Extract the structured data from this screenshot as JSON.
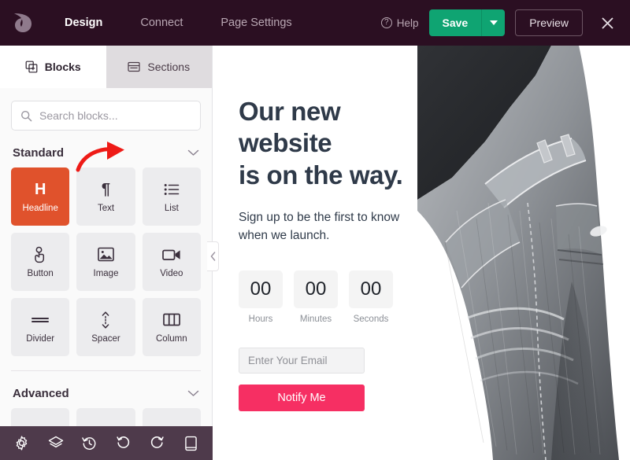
{
  "topbar": {
    "logo_icon": "leaf-logo-icon",
    "nav": [
      {
        "label": "Design",
        "active": true
      },
      {
        "label": "Connect",
        "active": false
      },
      {
        "label": "Page Settings",
        "active": false
      }
    ],
    "help_label": "Help",
    "help_icon": "question-circle-icon",
    "save_label": "Save",
    "save_caret_icon": "caret-down-icon",
    "preview_label": "Preview",
    "close_icon": "close-icon",
    "bg_color": "#2B0F22",
    "save_color": "#0FA472"
  },
  "sidebar": {
    "tabs": [
      {
        "label": "Blocks",
        "icon": "blocks-grid-icon",
        "active": true
      },
      {
        "label": "Sections",
        "icon": "sections-layout-icon",
        "active": false
      }
    ],
    "search": {
      "placeholder": "Search blocks...",
      "value": "",
      "icon": "search-icon"
    },
    "sections": [
      {
        "title": "Standard",
        "chevron_icon": "chevron-down-icon",
        "tiles": [
          {
            "label": "Headline",
            "icon": "headline-h-icon",
            "glyph": "H",
            "selected": true
          },
          {
            "label": "Text",
            "icon": "paragraph-pilcrow-icon",
            "glyph": "¶",
            "selected": false
          },
          {
            "label": "List",
            "icon": "bullet-list-icon",
            "glyph": "",
            "selected": false
          },
          {
            "label": "Button",
            "icon": "click-hand-icon",
            "glyph": "",
            "selected": false
          },
          {
            "label": "Image",
            "icon": "image-picture-icon",
            "glyph": "",
            "selected": false
          },
          {
            "label": "Video",
            "icon": "video-camera-icon",
            "glyph": "",
            "selected": false
          },
          {
            "label": "Divider",
            "icon": "divider-lines-icon",
            "glyph": "",
            "selected": false
          },
          {
            "label": "Spacer",
            "icon": "spacer-arrows-icon",
            "glyph": "",
            "selected": false
          },
          {
            "label": "Column",
            "icon": "column-layout-icon",
            "glyph": "",
            "selected": false
          }
        ]
      },
      {
        "title": "Advanced",
        "chevron_icon": "chevron-down-icon",
        "tiles": []
      }
    ],
    "selected_tile_color": "#E0522C",
    "collapse_handle_icon": "chevron-left-icon",
    "bottom_tools": [
      {
        "icon": "gear-settings-icon",
        "name": "settings"
      },
      {
        "icon": "layers-icon",
        "name": "layers"
      },
      {
        "icon": "history-clock-icon",
        "name": "history"
      },
      {
        "icon": "undo-icon",
        "name": "undo"
      },
      {
        "icon": "redo-icon",
        "name": "redo"
      },
      {
        "icon": "mobile-device-icon",
        "name": "device-preview"
      }
    ],
    "bottom_bar_color": "#4E3A4B"
  },
  "canvas": {
    "headline": "Our new website\nis on the way.",
    "headline_lines": [
      "Our new",
      "website",
      "is on the way."
    ],
    "subhead_lines": [
      "Sign up to be the first to know",
      "when we launch."
    ],
    "countdown": [
      {
        "value": "00",
        "label": "Hours"
      },
      {
        "value": "00",
        "label": "Minutes"
      },
      {
        "value": "00",
        "label": "Seconds"
      }
    ],
    "email_placeholder": "Enter Your Email",
    "email_value": "",
    "notify_label": "Notify Me",
    "notify_color": "#F62F63",
    "headline_color": "#2F3A49",
    "photo_alt": "grayscale-jeans-photo"
  },
  "annotation": {
    "arrow_icon": "red-curved-arrow-icon",
    "arrow_color": "#EE1B17"
  }
}
